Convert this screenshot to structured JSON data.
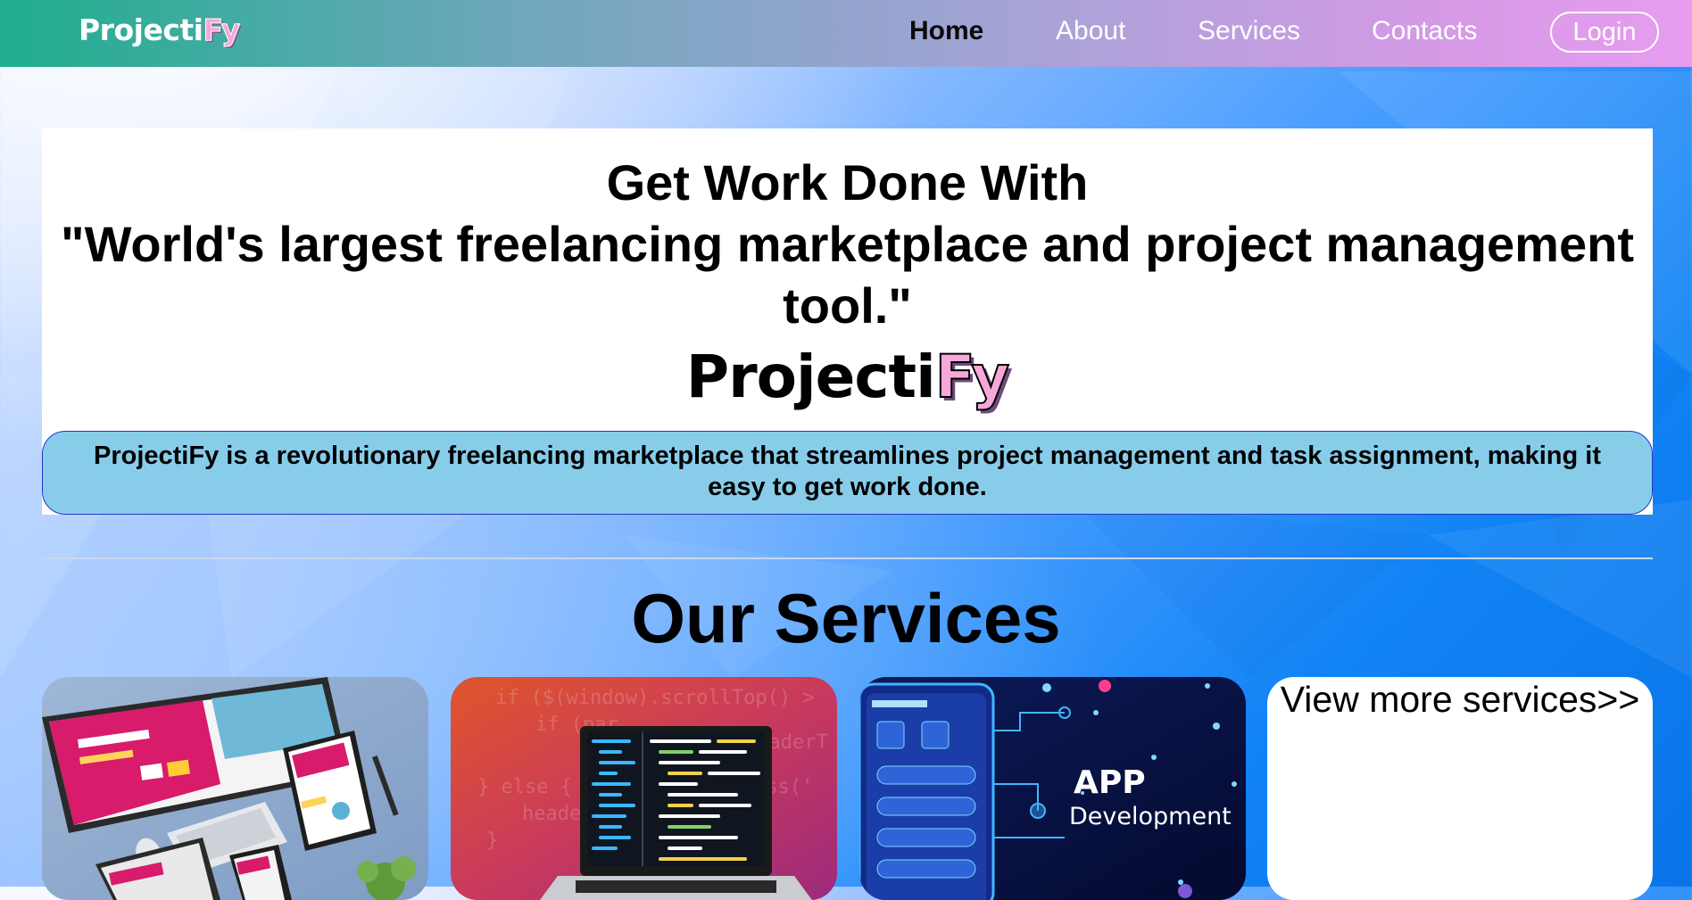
{
  "navbar": {
    "brand_main": "Projecti",
    "brand_accent": "Fy",
    "links": [
      "Home",
      "About",
      "Services",
      "Contacts"
    ],
    "active_link": "Home",
    "login_label": "Login"
  },
  "hero": {
    "heading_line1": "Get Work Done With",
    "heading_line2": "\"World's largest freelancing marketplace and project management tool.\"",
    "brand_main": "Projecti",
    "brand_accent": "Fy",
    "description": "ProjectiFy is a revolutionary freelancing marketplace that streamlines project management and task assignment, making it easy to get work done."
  },
  "services": {
    "title": "Our Services",
    "cards": [
      {
        "image": "responsive-web-design-devices-image"
      },
      {
        "image": "laptop-with-code-image"
      },
      {
        "image": "app-development-image",
        "text_line1": "APP",
        "text_line2": "Development"
      }
    ],
    "view_more_label": "View more services>>"
  },
  "colors": {
    "navbar_start": "#1fae8e",
    "navbar_end": "#e79cf0",
    "accent_pink": "#f7a8d9",
    "description_bg": "#87cdea",
    "description_border": "#2a33c9"
  }
}
